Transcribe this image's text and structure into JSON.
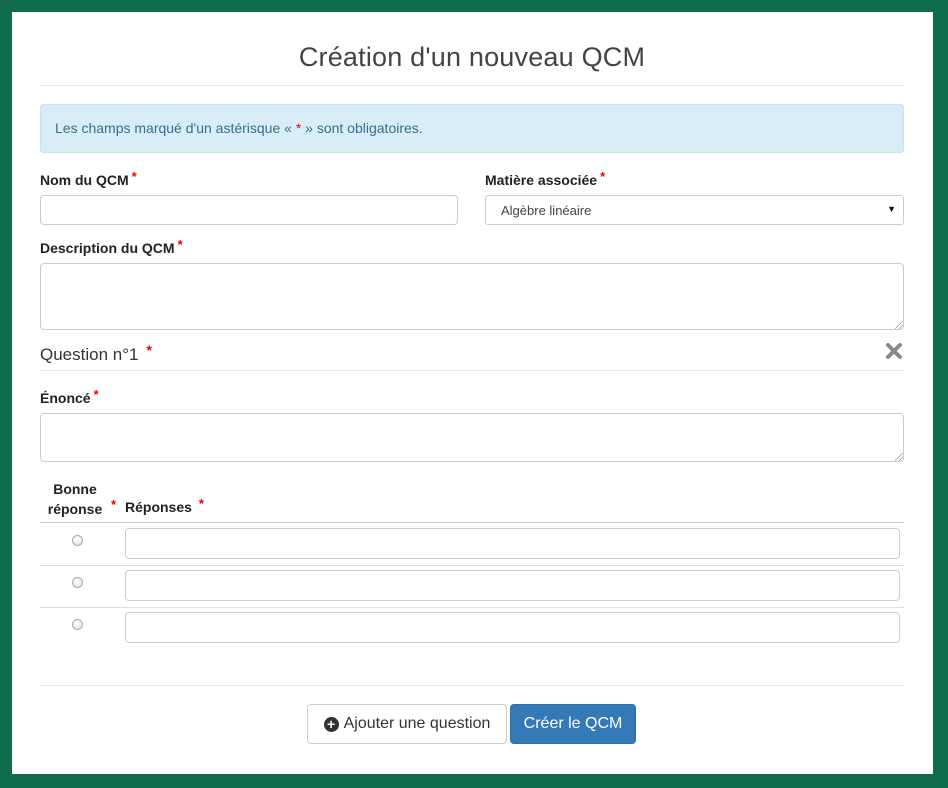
{
  "form": {
    "title": "Création d'un nouveau QCM",
    "alert_prefix": "Les champs marqué d'un astérisque « ",
    "alert_star": "*",
    "alert_suffix": " » sont obligatoires.",
    "required_mark": "*",
    "name_label": "Nom du QCM",
    "name_value": "",
    "subject_label": "Matière associée",
    "subject_selected": "Algèbre linéaire",
    "description_label": "Description du QCM",
    "description_value": ""
  },
  "question": {
    "title": "Question n°1",
    "statement_label": "Énoncé",
    "statement_value": "",
    "col_correct": "Bonne réponse",
    "col_answers": "Réponses",
    "answers": [
      "",
      "",
      ""
    ]
  },
  "buttons": {
    "add_question": "Ajouter une question",
    "create": "Créer le QCM"
  },
  "icons": {
    "close": "close-icon",
    "add": "plus-circle-icon",
    "select_caret": "caret-down-icon"
  },
  "colors": {
    "background": "#0e6b4e",
    "alert_bg": "#d9edf7",
    "primary": "#337ab7",
    "required": "#e00000"
  }
}
